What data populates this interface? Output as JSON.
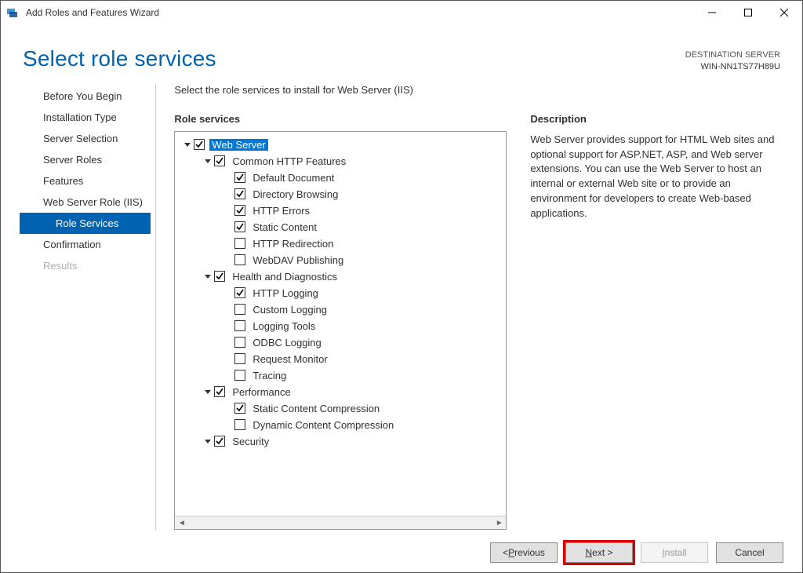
{
  "window": {
    "title": "Add Roles and Features Wizard"
  },
  "header": {
    "page_title": "Select role services",
    "destination_label": "DESTINATION SERVER",
    "destination_name": "WIN-NN1TS77H89U"
  },
  "nav": {
    "items": [
      {
        "label": "Before You Begin",
        "selected": false,
        "sub": false
      },
      {
        "label": "Installation Type",
        "selected": false,
        "sub": false
      },
      {
        "label": "Server Selection",
        "selected": false,
        "sub": false
      },
      {
        "label": "Server Roles",
        "selected": false,
        "sub": false
      },
      {
        "label": "Features",
        "selected": false,
        "sub": false
      },
      {
        "label": "Web Server Role (IIS)",
        "selected": false,
        "sub": false
      },
      {
        "label": "Role Services",
        "selected": true,
        "sub": true
      },
      {
        "label": "Confirmation",
        "selected": false,
        "sub": false
      },
      {
        "label": "Results",
        "selected": false,
        "sub": false,
        "disabled": true
      }
    ]
  },
  "main": {
    "instruction": "Select the role services to install for Web Server (IIS)",
    "role_services_label": "Role services",
    "description_label": "Description",
    "description_text": "Web Server provides support for HTML Web sites and optional support for ASP.NET, ASP, and Web server extensions. You can use the Web Server to host an internal or external Web site or to provide an environment for developers to create Web-based applications."
  },
  "tree": [
    {
      "depth": 0,
      "expander": "expanded",
      "checked": true,
      "label": "Web Server",
      "highlighted": true
    },
    {
      "depth": 1,
      "expander": "expanded",
      "checked": true,
      "label": "Common HTTP Features"
    },
    {
      "depth": 2,
      "expander": "none",
      "checked": true,
      "label": "Default Document"
    },
    {
      "depth": 2,
      "expander": "none",
      "checked": true,
      "label": "Directory Browsing"
    },
    {
      "depth": 2,
      "expander": "none",
      "checked": true,
      "label": "HTTP Errors"
    },
    {
      "depth": 2,
      "expander": "none",
      "checked": true,
      "label": "Static Content"
    },
    {
      "depth": 2,
      "expander": "none",
      "checked": false,
      "label": "HTTP Redirection"
    },
    {
      "depth": 2,
      "expander": "none",
      "checked": false,
      "label": "WebDAV Publishing"
    },
    {
      "depth": 1,
      "expander": "expanded",
      "checked": true,
      "label": "Health and Diagnostics"
    },
    {
      "depth": 2,
      "expander": "none",
      "checked": true,
      "label": "HTTP Logging"
    },
    {
      "depth": 2,
      "expander": "none",
      "checked": false,
      "label": "Custom Logging"
    },
    {
      "depth": 2,
      "expander": "none",
      "checked": false,
      "label": "Logging Tools"
    },
    {
      "depth": 2,
      "expander": "none",
      "checked": false,
      "label": "ODBC Logging"
    },
    {
      "depth": 2,
      "expander": "none",
      "checked": false,
      "label": "Request Monitor"
    },
    {
      "depth": 2,
      "expander": "none",
      "checked": false,
      "label": "Tracing"
    },
    {
      "depth": 1,
      "expander": "expanded",
      "checked": true,
      "label": "Performance"
    },
    {
      "depth": 2,
      "expander": "none",
      "checked": true,
      "label": "Static Content Compression"
    },
    {
      "depth": 2,
      "expander": "none",
      "checked": false,
      "label": "Dynamic Content Compression"
    },
    {
      "depth": 1,
      "expander": "expanded",
      "checked": true,
      "label": "Security"
    }
  ],
  "footer": {
    "previous_html": "< <span class='ul'>P</span>revious",
    "next_html": "<span class='ul'>N</span>ext >",
    "install_html": "<span class='ul'>I</span>nstall",
    "cancel": "Cancel"
  }
}
